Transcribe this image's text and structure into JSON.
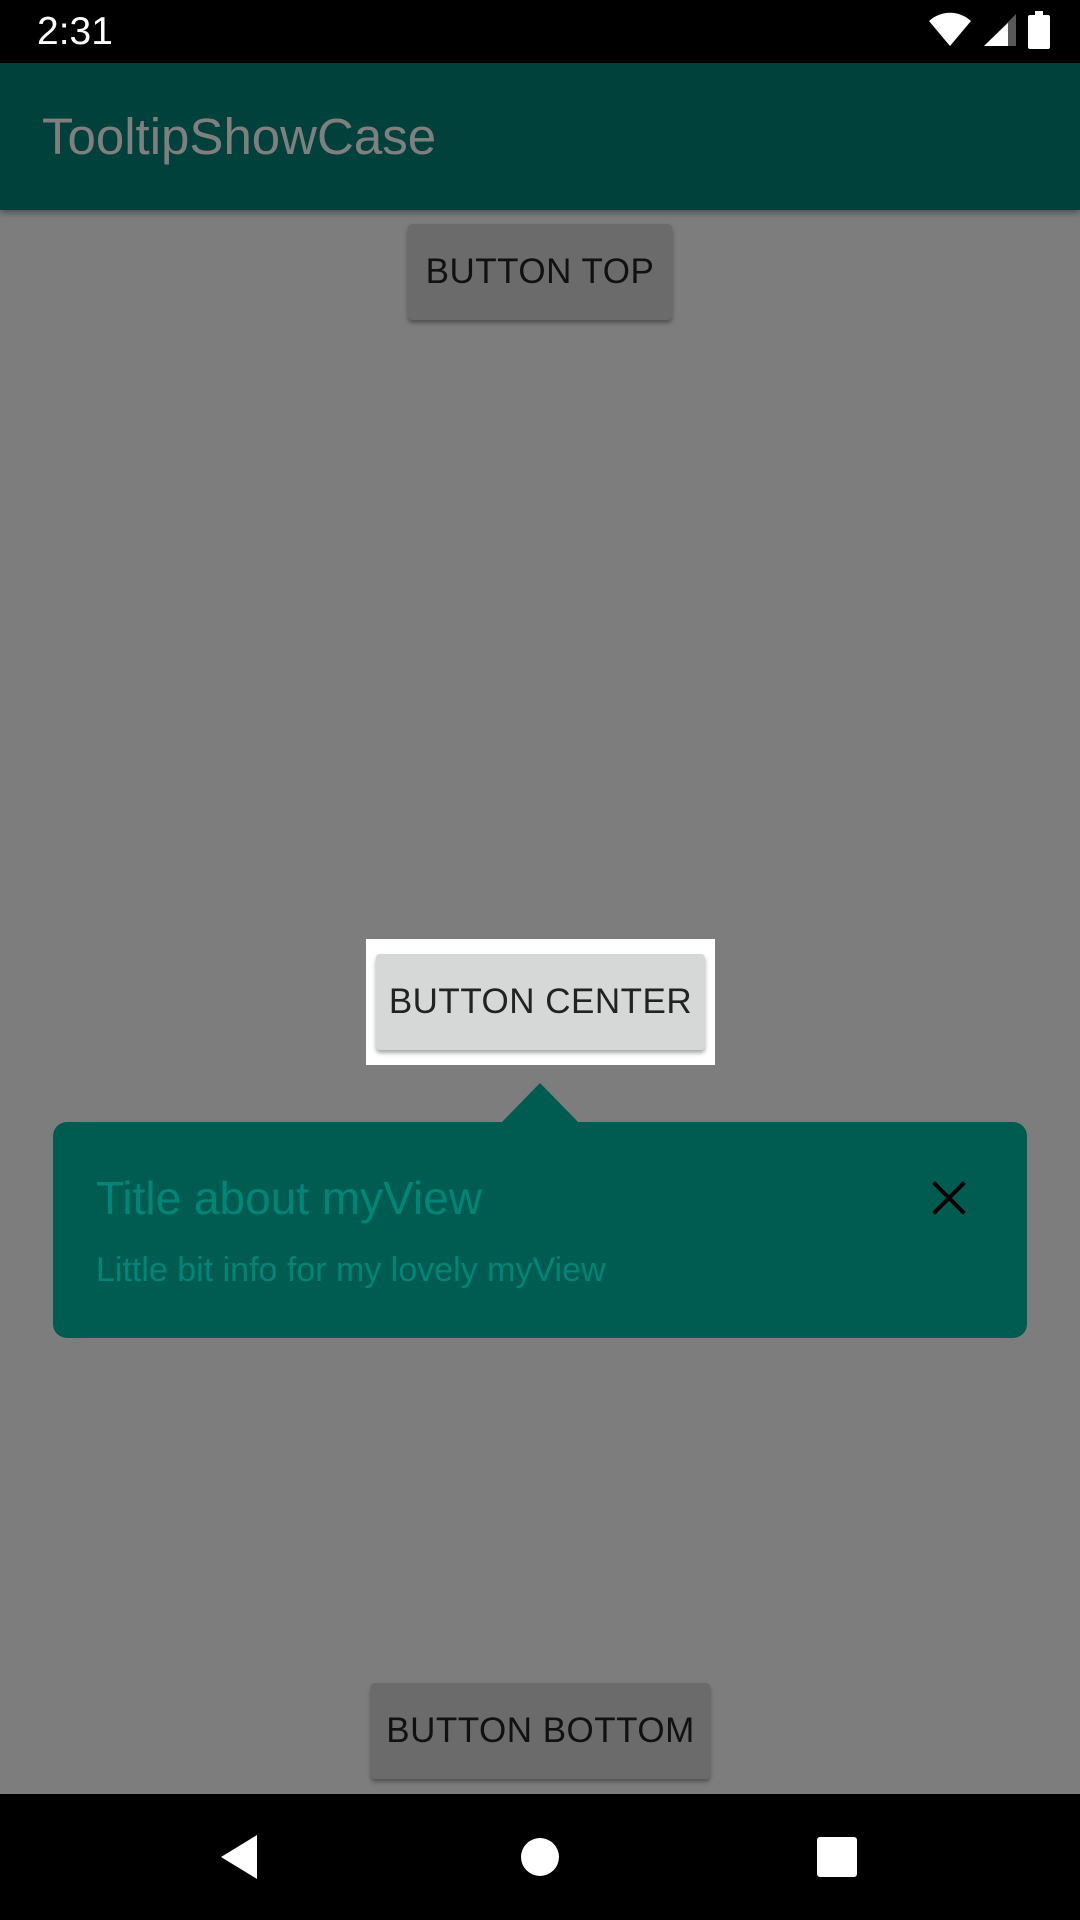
{
  "status_bar": {
    "time": "2:31",
    "icons": [
      "wifi-icon",
      "cell-signal-icon",
      "battery-icon"
    ]
  },
  "app_bar": {
    "title": "TooltipShowCase",
    "color": "#008577"
  },
  "buttons": {
    "top_label": "BUTTON TOP",
    "center_label": "BUTTON CENTER",
    "bottom_label": "BUTTON BOTTOM"
  },
  "tooltip": {
    "title": "Title about myView",
    "description": "Little bit info for my lovely myView",
    "background_color": "#005b51",
    "text_color": "#008577",
    "close_icon": "close-icon"
  },
  "nav_bar": {
    "icons": [
      "back-icon",
      "home-icon",
      "recents-icon"
    ]
  }
}
